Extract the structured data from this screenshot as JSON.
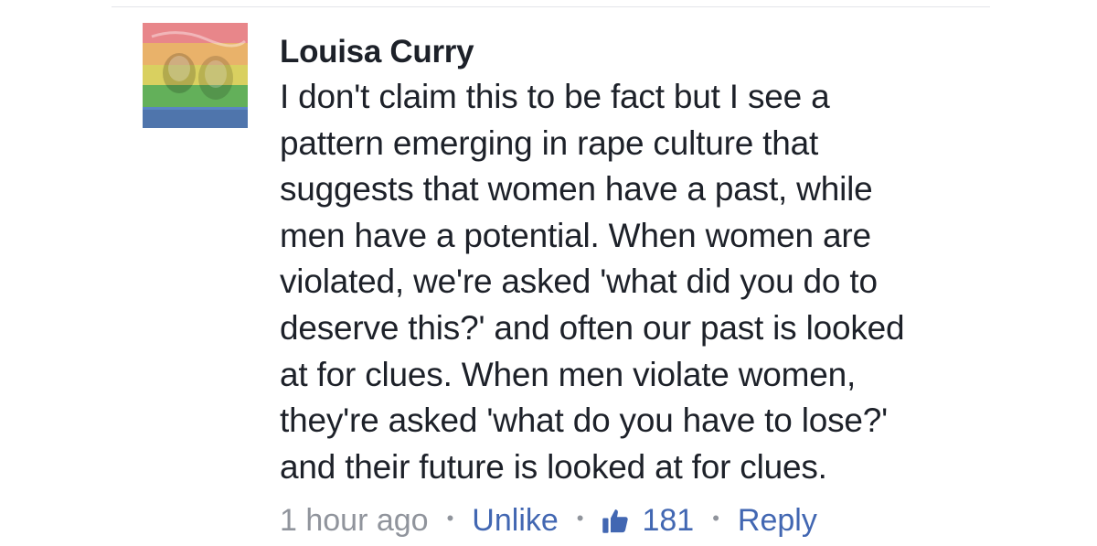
{
  "comment": {
    "author": "Louisa Curry",
    "text_lines": [
      "I don't claim this to be fact but I see a",
      "pattern emerging in rape culture that",
      "suggests that women have a past, while",
      "men have a potential. When women are",
      "violated, we're asked 'what did you do to",
      "deserve this?' and often our past is looked",
      "at for clues. When men violate women,",
      "they're asked 'what do you have to lose?'",
      "and their future is looked at for clues."
    ],
    "timestamp": "1 hour ago",
    "unlike_label": "Unlike",
    "like_count": "181",
    "reply_label": "Reply",
    "separator": "•",
    "avatar_icon": "rainbow-filter-profile-photo",
    "like_icon": "thumbs-up-icon"
  },
  "colors": {
    "author_text": "#1d2129",
    "body_text": "#1d2129",
    "meta_gray": "#90949c",
    "link_blue": "#4267b2",
    "divider": "#e3e5e9"
  }
}
